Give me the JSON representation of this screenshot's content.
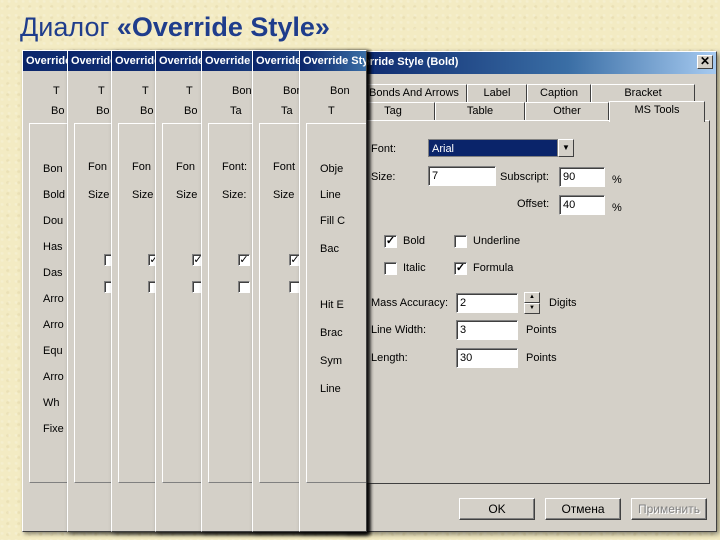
{
  "slide": {
    "title_prefix": "Диалог ",
    "title_bold": "«Override Style»"
  },
  "background_dialogs": [
    {
      "title": "Override Style (Bonds)",
      "tab_row1": "T",
      "tab_row2": "Bo",
      "rows": [
        "Bon",
        "Bold",
        "Dou",
        "Has",
        "Das",
        "Arro",
        "Arro",
        "Equ",
        "Arro",
        "Wh",
        "Fixe"
      ]
    },
    {
      "title": "Override Style (Text)",
      "tab_row1": "T",
      "tab_row2": "Bo",
      "rows": [
        "Fon",
        "Size"
      ],
      "checks": [
        "",
        ""
      ]
    },
    {
      "title": "Override Style (Text)",
      "tab_row1": "T",
      "tab_row2": "Bo",
      "rows": [
        "Fon",
        "Size"
      ],
      "checks": [
        "✓",
        ""
      ]
    },
    {
      "title": "Override Style (Text)",
      "tab_row1": "T",
      "tab_row2": "Bo",
      "rows": [
        "Fon",
        "Size"
      ],
      "checks": [
        "✓",
        ""
      ]
    },
    {
      "title": "Override Style (Text)",
      "tab_row1": "Bond",
      "tab_row2": "Ta",
      "rows": [
        "Font:",
        "Size:"
      ],
      "checks": [
        "✓",
        ""
      ]
    },
    {
      "title": "Override Style (Text)",
      "tab_row1": "Bon",
      "tab_row2": "Ta",
      "rows": [
        "Font",
        "Size"
      ],
      "checks": [
        "✓",
        ""
      ]
    },
    {
      "title": "Override Style (Object)",
      "tab_row1": "Bon",
      "tab_row2": "T",
      "rows": [
        "Obje",
        "Line",
        "Fill C",
        "Bac",
        "",
        "Hit E",
        "Brac",
        "Sym",
        "Line"
      ]
    }
  ],
  "dialog": {
    "title": "Override Style (Bold)",
    "close": "✕",
    "tabs_row1": [
      "Bonds And Arrows",
      "Label",
      "Caption",
      "Bracket"
    ],
    "tabs_row2": [
      "Tag",
      "Table",
      "Other",
      "MS Tools"
    ],
    "font_label": "Font:",
    "font_value": "Arial",
    "size_label": "Size:",
    "size_value": "7",
    "subscript_label": "Subscript:",
    "subscript_value": "90",
    "subscript_unit": "%",
    "offset_label": "Offset:",
    "offset_value": "40",
    "offset_unit": "%",
    "bold_label": "Bold",
    "bold_checked": "✓",
    "underline_label": "Underline",
    "italic_label": "Italic",
    "formula_label": "Formula",
    "formula_checked": "✓",
    "mass_label": "Mass Accuracy:",
    "mass_value": "2",
    "mass_unit": "Digits",
    "line_width_label": "Line Width:",
    "line_width_value": "3",
    "line_width_unit": "Points",
    "length_label": "Length:",
    "length_value": "30",
    "length_unit": "Points",
    "ok": "OK",
    "cancel": "Отмена",
    "apply": "Применить"
  }
}
